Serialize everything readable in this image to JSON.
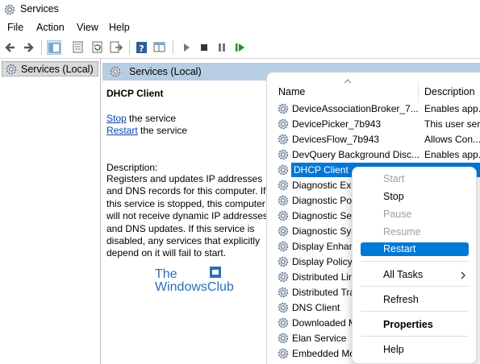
{
  "window": {
    "title": "Services"
  },
  "menu": [
    "File",
    "Action",
    "View",
    "Help"
  ],
  "toolbar": [
    "back-icon",
    "forward-icon",
    "console-tree-icon",
    "properties-icon",
    "refresh-icon",
    "export-list-icon",
    "help-icon",
    "view-icon",
    "play-icon",
    "stop-icon",
    "pause-icon",
    "restart-icon"
  ],
  "tree": {
    "root_label": "Services (Local)"
  },
  "pane_header": {
    "label": "Services (Local)"
  },
  "details": {
    "service_name": "DHCP Client",
    "stop_link": "Stop",
    "stop_suffix": " the service",
    "restart_link": "Restart",
    "restart_suffix": " the service",
    "description_label": "Description:",
    "description_lines": [
      "Registers and updates IP addresses",
      "and DNS records for this computer. If",
      "this service is stopped, this computer",
      "will not receive dynamic IP addresses",
      "and DNS updates. If this service is",
      "disabled, any services that explicitly",
      "depend on it will fail to start."
    ]
  },
  "watermark": {
    "line1": "The",
    "line2": "WindowsClub"
  },
  "list": {
    "columns": {
      "name": "Name",
      "description": "Description"
    },
    "rows": [
      {
        "name": "DeviceAssociationBroker_7...",
        "description": "Enables app..."
      },
      {
        "name": "DevicePicker_7b943",
        "description": "This user ser..."
      },
      {
        "name": "DevicesFlow_7b943",
        "description": "Allows Con..."
      },
      {
        "name": "DevQuery Background Disc...",
        "description": "Enables app..."
      },
      {
        "name": "DHCP Client",
        "description": "",
        "selected": true
      },
      {
        "name": "Diagnostic Exe",
        "description": ""
      },
      {
        "name": "Diagnostic Pol",
        "description": ""
      },
      {
        "name": "Diagnostic Ser",
        "description": ""
      },
      {
        "name": "Diagnostic Sys",
        "description": ""
      },
      {
        "name": "Display Enhan",
        "description": ""
      },
      {
        "name": "Display Policy",
        "description": ""
      },
      {
        "name": "Distributed Lin",
        "description": ""
      },
      {
        "name": "Distributed Tra",
        "description": ""
      },
      {
        "name": "DNS Client",
        "description": ""
      },
      {
        "name": "Downloaded M",
        "description": ""
      },
      {
        "name": "Elan Service",
        "description": ""
      },
      {
        "name": "Embedded Mo",
        "description": ""
      }
    ]
  },
  "context_menu": {
    "items": [
      {
        "label": "Start",
        "state": "disabled"
      },
      {
        "label": "Stop",
        "state": "enabled"
      },
      {
        "label": "Pause",
        "state": "disabled"
      },
      {
        "label": "Resume",
        "state": "disabled"
      },
      {
        "label": "Restart",
        "state": "highlighted"
      },
      {
        "label": "All Tasks",
        "state": "submenu"
      },
      {
        "label": "Refresh",
        "state": "enabled"
      },
      {
        "label": "Properties",
        "state": "bold"
      },
      {
        "label": "Help",
        "state": "enabled"
      }
    ]
  },
  "colors": {
    "accent": "#0078d7",
    "pane_header": "#b7cde3",
    "link": "#0645ad",
    "disabled": "#9e9e9e"
  }
}
